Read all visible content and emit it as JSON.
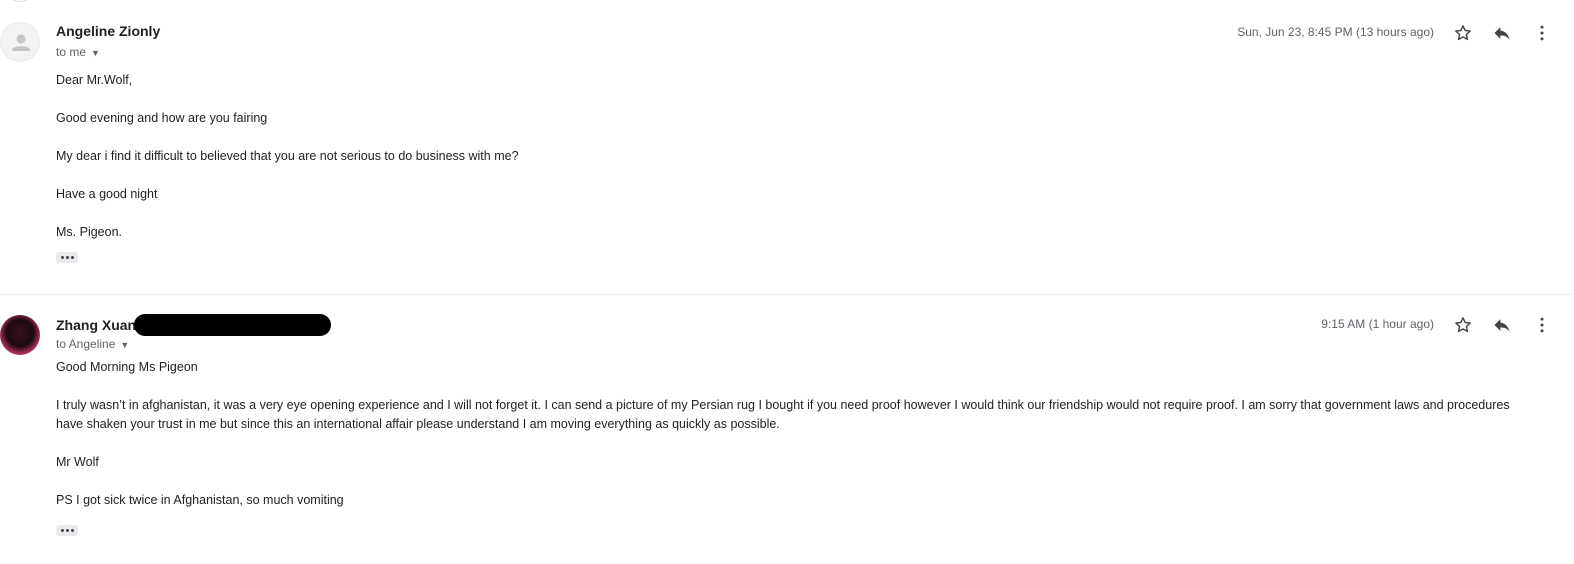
{
  "messages": [
    {
      "sender": "Angeline Zionly",
      "recipient": "to me",
      "date": "Sun, Jun 23, 8:45 PM (13 hours ago)",
      "body": [
        "Dear Mr.Wolf,",
        "Good evening and how are you fairing",
        "My dear i find it difficult to believed that you are not serious to do business with me?",
        "Have a good night",
        "Ms. Pigeon."
      ]
    },
    {
      "sender": "Zhang Xuan",
      "recipient": "to Angeline",
      "date": "9:15 AM (1 hour ago)",
      "body": [
        "Good Morning Ms Pigeon",
        "I truly wasn’t in afghanistan, it was a very eye opening experience and I will not forget it. I can send a picture of my Persian rug I bought if you need proof however I would think our friendship would not require proof. I am sorry that government laws and procedures have shaken your trust in me but since this an international affair please understand I am moving everything as quickly as possible.",
        "Mr Wolf",
        "PS I got sick twice in Afghanistan, so much vomiting"
      ]
    }
  ],
  "icons": {
    "star": "star-icon",
    "reply": "reply-icon",
    "more": "more-vertical-icon",
    "caret": "caret-down-icon",
    "ellipsis": "show-trimmed-content-icon"
  }
}
